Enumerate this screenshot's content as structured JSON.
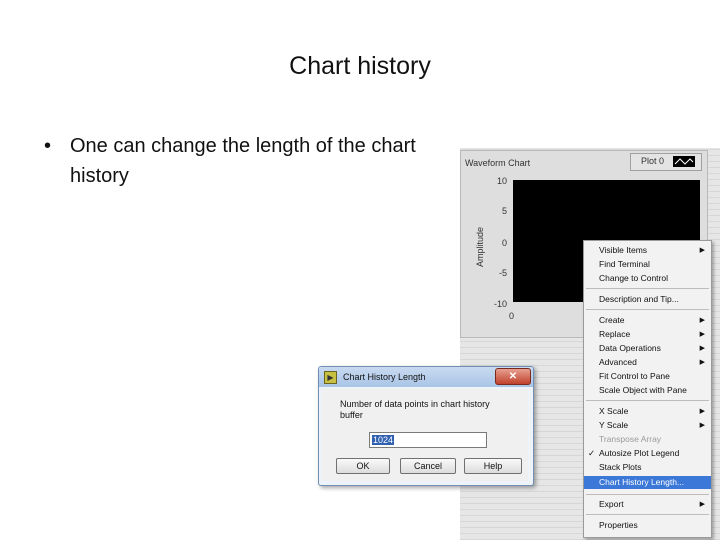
{
  "slide": {
    "title": "Chart history",
    "bullet": "One can change the length of the chart history",
    "bullet_marker": "•"
  },
  "waveform_chart": {
    "label": "Waveform Chart",
    "y_axis_label": "Amplitude",
    "y_ticks": [
      "10",
      "5",
      "0",
      "-5",
      "-10"
    ],
    "x_ticks": [
      "0"
    ],
    "plot_legend": "Plot 0",
    "plot_legend_icon": "line-style-icon",
    "plot_background": "#000000"
  },
  "context_menu": {
    "items": [
      {
        "label": "Visible Items",
        "submenu": true
      },
      {
        "label": "Find Terminal"
      },
      {
        "label": "Change to Control"
      },
      {
        "label": "Description and Tip..."
      },
      {
        "label": "Create",
        "submenu": true
      },
      {
        "label": "Replace",
        "submenu": true
      },
      {
        "label": "Data Operations",
        "submenu": true
      },
      {
        "label": "Advanced",
        "submenu": true
      },
      {
        "label": "Fit Control to Pane"
      },
      {
        "label": "Scale Object with Pane"
      },
      {
        "label": "X Scale",
        "submenu": true
      },
      {
        "label": "Y Scale",
        "submenu": true
      },
      {
        "label": "Transpose Array",
        "disabled": true
      },
      {
        "label": "Autosize Plot Legend",
        "checked": true
      },
      {
        "label": "Stack Plots"
      },
      {
        "label": "Chart History Length...",
        "selected": true
      },
      {
        "label": "Export",
        "submenu": true
      },
      {
        "label": "Properties"
      }
    ],
    "submenu_arrow": "▶",
    "check_mark": "✓",
    "selected_color": "#3b78d8"
  },
  "dialog": {
    "title": "Chart History Length",
    "close": "✕",
    "prompt": "Number of data points in chart history buffer",
    "value": "1024",
    "ok": "OK",
    "cancel": "Cancel",
    "help": "Help"
  }
}
